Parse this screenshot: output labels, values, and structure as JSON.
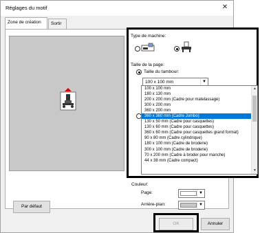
{
  "dialog": {
    "title": "Réglages du motif",
    "close_glyph": "✕"
  },
  "tabs": [
    {
      "label": "Zone de création"
    },
    {
      "label": "Sortir"
    }
  ],
  "buttons": {
    "default": "Par défaut",
    "ok": "OK",
    "cancel": "Annuler"
  },
  "machine": {
    "label": "Type de machine:",
    "options": [
      {
        "icon": "embroidery-machine-icon",
        "selected": false
      },
      {
        "icon": "sewing-machine-icon",
        "selected": true
      }
    ]
  },
  "page_size": {
    "label": "Taille de la page:",
    "hoop_label": "Taille du tambour:",
    "hoop_value": "100 x 100 mm",
    "hoop_options": [
      "100 x 100 mm",
      "180 x 130 mm",
      "200 x 200 mm (Cadre pour matelassage)",
      "300 x 200 mm",
      "360 x 200 mm",
      "360 x 360 mm (Cadre Jumbo)",
      "130 x  50 mm (Cadre pour casquettes)",
      "130 x  60 mm (Cadre pour casquettes)",
      "360 x  60 mm (Cadre pour casquettes grand format)",
      " 90 x  80 mm (Cadre cylindrique)",
      "180 x 100 mm (Cadre de broderie)",
      "300 x 100 mm (Cadre de broderie)",
      " 70 x 200 mm (Cadre à broder pour manche)",
      " 44 x  38 mm (Cadre compact)"
    ],
    "selected_index": 5
  },
  "color": {
    "label": "Couleur:",
    "page_label": "Page:",
    "background_label": "Arrière-plan:",
    "page_swatch": "#ffffff",
    "background_swatch": "#c8c8c8"
  }
}
